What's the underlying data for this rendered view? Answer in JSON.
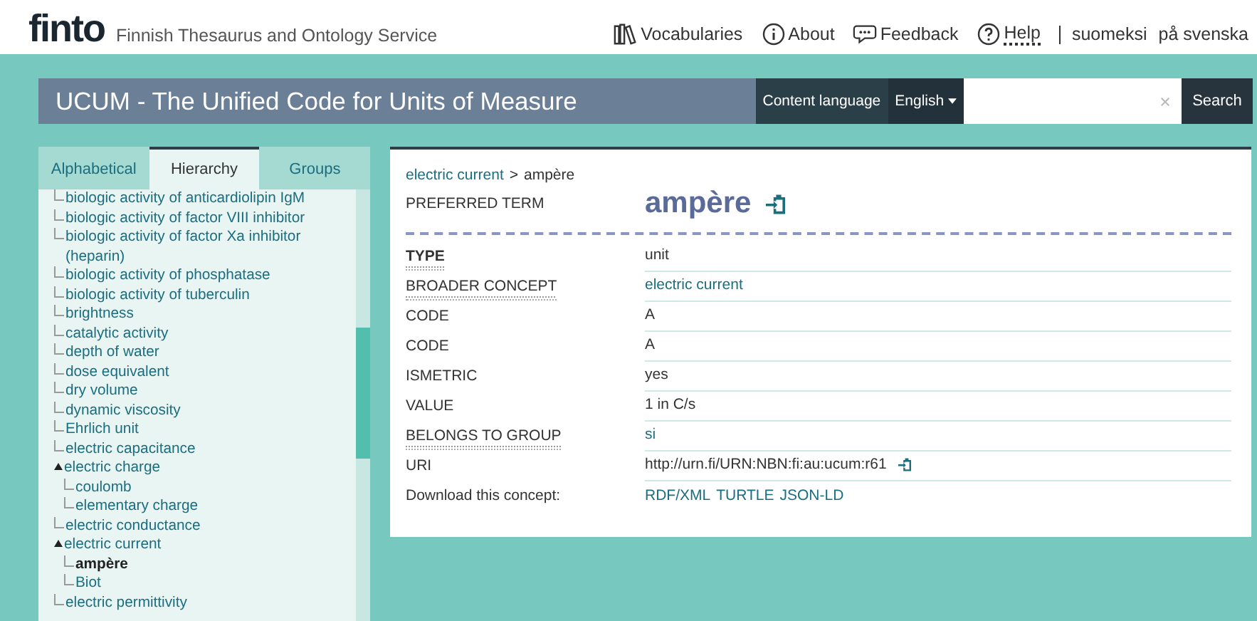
{
  "header": {
    "logo": "finto",
    "tagline": "Finnish Thesaurus and Ontology Service",
    "nav": [
      {
        "label": "Vocabularies"
      },
      {
        "label": "About"
      },
      {
        "label": "Feedback"
      },
      {
        "label": "Help"
      }
    ],
    "languages": [
      "suomeksi",
      "på svenska"
    ]
  },
  "vocab_bar": {
    "title": "UCUM - The Unified Code for Units of Measure",
    "content_language_label": "Content language",
    "content_language": "English",
    "search_button": "Search"
  },
  "sidebar": {
    "tabs": [
      {
        "label": "Alphabetical",
        "selected": false
      },
      {
        "label": "Hierarchy",
        "selected": true
      },
      {
        "label": "Groups",
        "selected": false
      }
    ],
    "tree": [
      {
        "label": "biologic activity of anticardiolipin IgM"
      },
      {
        "label": "biologic activity of factor VIII inhibitor"
      },
      {
        "label": "biologic activity of factor Xa inhibitor (heparin)"
      },
      {
        "label": "biologic activity of phosphatase"
      },
      {
        "label": "biologic activity of tuberculin"
      },
      {
        "label": "brightness"
      },
      {
        "label": "catalytic activity"
      },
      {
        "label": "depth of water"
      },
      {
        "label": "dose equivalent"
      },
      {
        "label": "dry volume"
      },
      {
        "label": "dynamic viscosity"
      },
      {
        "label": "Ehrlich unit"
      },
      {
        "label": "electric capacitance"
      },
      {
        "label": "electric charge",
        "expanded": true,
        "children": [
          {
            "label": "coulomb",
            "selected": false
          },
          {
            "label": "elementary charge",
            "selected": false
          }
        ]
      },
      {
        "label": "electric conductance"
      },
      {
        "label": "electric current",
        "expanded": true,
        "children": [
          {
            "label": "ampère",
            "selected": true
          },
          {
            "label": "Biot",
            "selected": false
          }
        ]
      },
      {
        "label": "electric permittivity"
      }
    ]
  },
  "concept": {
    "breadcrumb_separator": ">",
    "breadcrumb": [
      {
        "label": "electric current",
        "kind": "link"
      },
      {
        "label": "ampère",
        "kind": "text"
      }
    ],
    "preferred_term_label": "PREFERRED TERM",
    "preferred_term": "ampère",
    "properties": [
      {
        "label": "TYPE",
        "tooltip": true,
        "bold": true,
        "value": "unit",
        "kind": "text"
      },
      {
        "label": "BROADER CONCEPT",
        "tooltip": true,
        "bold": false,
        "value": "electric current",
        "kind": "link"
      },
      {
        "label": "CODE",
        "tooltip": false,
        "bold": false,
        "value": "A",
        "kind": "text"
      },
      {
        "label": "CODE",
        "tooltip": false,
        "bold": false,
        "value": "A",
        "kind": "text"
      },
      {
        "label": "ISMETRIC",
        "tooltip": false,
        "bold": false,
        "value": "yes",
        "kind": "text"
      },
      {
        "label": "VALUE",
        "tooltip": false,
        "bold": false,
        "value": "1 in C/s",
        "kind": "text"
      },
      {
        "label": "BELONGS TO GROUP",
        "tooltip": true,
        "bold": false,
        "value": "si",
        "kind": "link"
      },
      {
        "label": "URI",
        "tooltip": false,
        "bold": false,
        "value": "http://urn.fi/URN:NBN:fi:au:ucum:r61",
        "kind": "uri"
      }
    ],
    "download_label": "Download this concept:",
    "downloads": [
      "RDF/XML",
      "TURTLE",
      "JSON-LD"
    ]
  }
}
